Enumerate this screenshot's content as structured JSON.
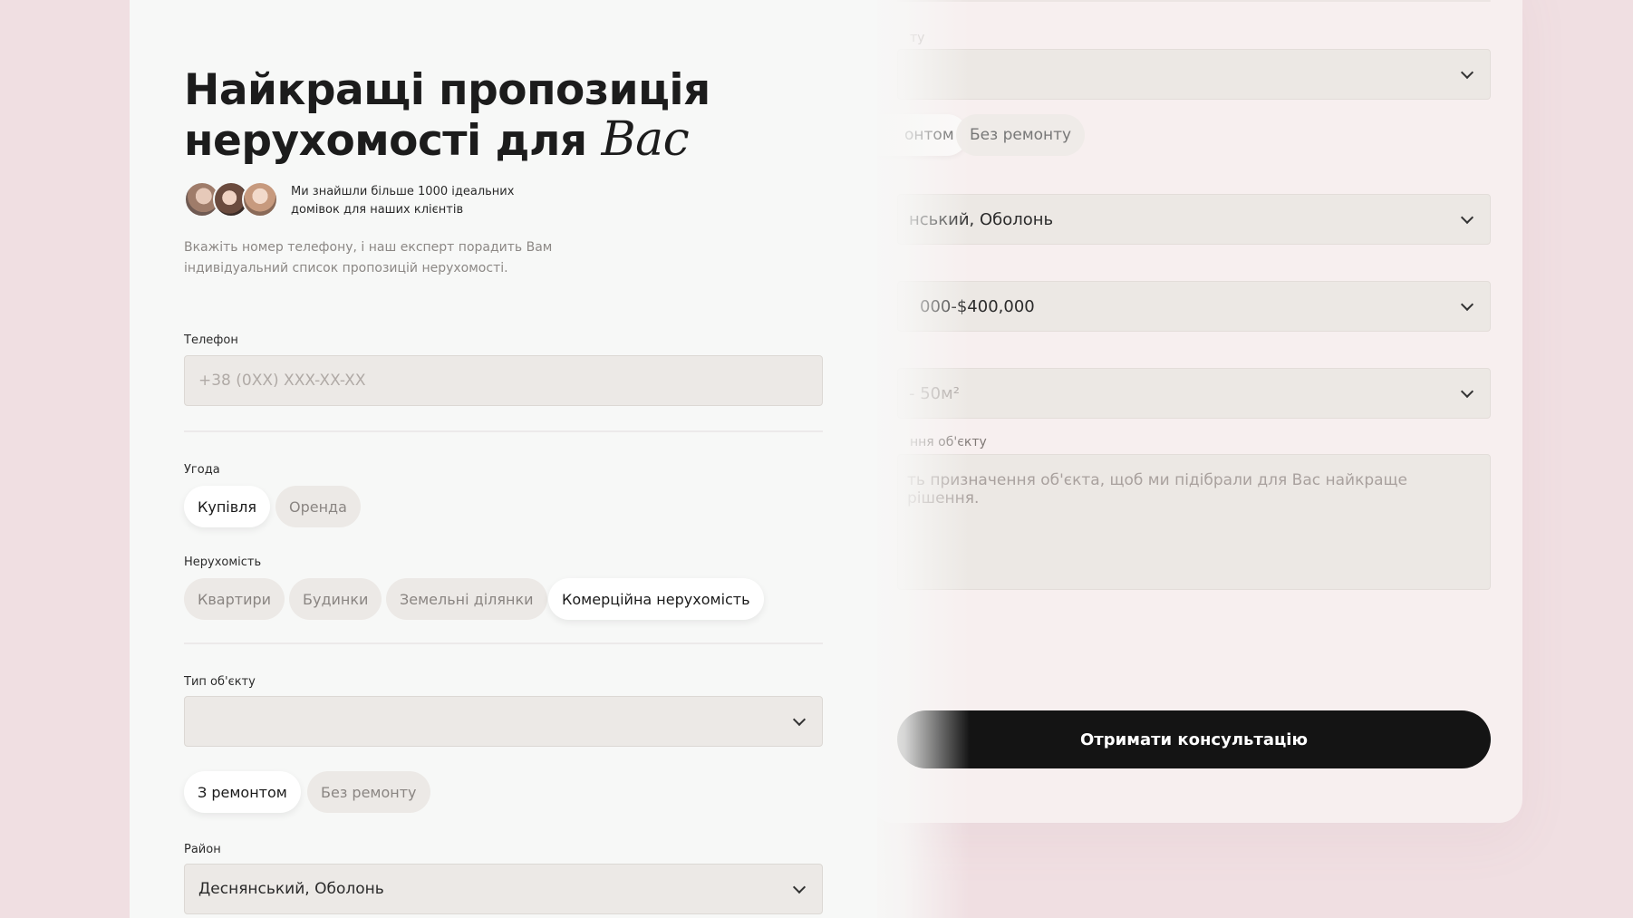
{
  "form": {
    "title_line1": "Найкращі пропозиція",
    "title_line2": "нерухомості для",
    "title_script": "Вас",
    "social_proof": "Ми знайшли більше 1000 ідеальних домівок для наших клієнтів",
    "description": "Вкажіть номер телефону, і наш експерт порадить Вам індивідуальний список пропозицій нерухомості.",
    "phone": {
      "label": "Телефон",
      "placeholder": "+38 (0XX) XXX-XX-XX"
    },
    "deal": {
      "label": "Угода",
      "options": [
        "Купівля",
        "Оренда"
      ],
      "selected": "Купівля"
    },
    "property": {
      "label": "Нерухомість",
      "options": [
        "Квартири",
        "Будинки",
        "Земельні ділянки",
        "Комерційна нерухомість"
      ],
      "selected": "Комерційна нерухомість"
    },
    "object_type": {
      "label": "Тип об'єкту",
      "value": ""
    },
    "repair": {
      "options": [
        "З ремонтом",
        "Без ремонту"
      ],
      "selected": "З ремонтом"
    },
    "district": {
      "label": "Район",
      "value": "Деснянський, Оболонь"
    }
  },
  "back_form": {
    "type_label_fragment": "ту",
    "repair_fragment": "онтом",
    "repair_other": "Без ремонту",
    "district_fragment": "нський, Оболонь",
    "price_fragment": "000-$400,000",
    "area_fragment": "- 50м²",
    "purpose_label_fragment": "ння об'єкту",
    "purpose_placeholder_fragment": "ть призначення об'єкта, щоб ми підібрали для Вас найкраще рішення.",
    "submit_label": "Отримати консультацію"
  }
}
